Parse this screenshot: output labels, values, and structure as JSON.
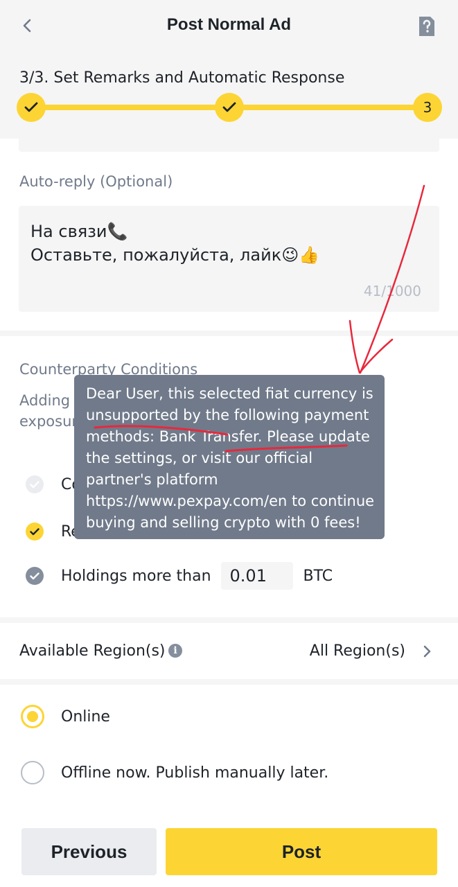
{
  "header": {
    "title": "Post Normal Ad",
    "step_title": "3/3. Set Remarks and Automatic Response",
    "steps": [
      {
        "state": "done",
        "label": ""
      },
      {
        "state": "done",
        "label": ""
      },
      {
        "state": "current",
        "label": "3"
      }
    ]
  },
  "auto_reply": {
    "label": "Auto-reply (Optional)",
    "text": "На связи📞\nОставьте, пожалуйста, лайк😉👍",
    "counter": "41/1000"
  },
  "conditions": {
    "label": "Counterparty Conditions",
    "desc_line1": "Adding",
    "desc_line2": "exposur",
    "rows": [
      {
        "label": "Co",
        "checked": "disabled"
      },
      {
        "label": "Re",
        "checked": "on"
      },
      {
        "label": "Holdings more than",
        "checked": "grey",
        "amount": "0.01",
        "unit": "BTC"
      }
    ]
  },
  "region": {
    "label": "Available Region(s)",
    "value": "All Region(s)"
  },
  "publish": {
    "options": [
      {
        "label": "Online",
        "selected": true
      },
      {
        "label": "Offline now. Publish manually later.",
        "selected": false
      }
    ]
  },
  "buttons": {
    "previous": "Previous",
    "post": "Post"
  },
  "tooltip": {
    "text": "Dear User, this selected fiat currency is unsupported by the following payment methods: Bank Transfer. Please update the settings, or visit our official partner's platform https://www.pexpay.com/en to continue buying and selling crypto with 0 fees!"
  },
  "colors": {
    "accent": "#fcd535",
    "tooltip_bg": "#707a8a",
    "annotation": "#e8283c"
  }
}
